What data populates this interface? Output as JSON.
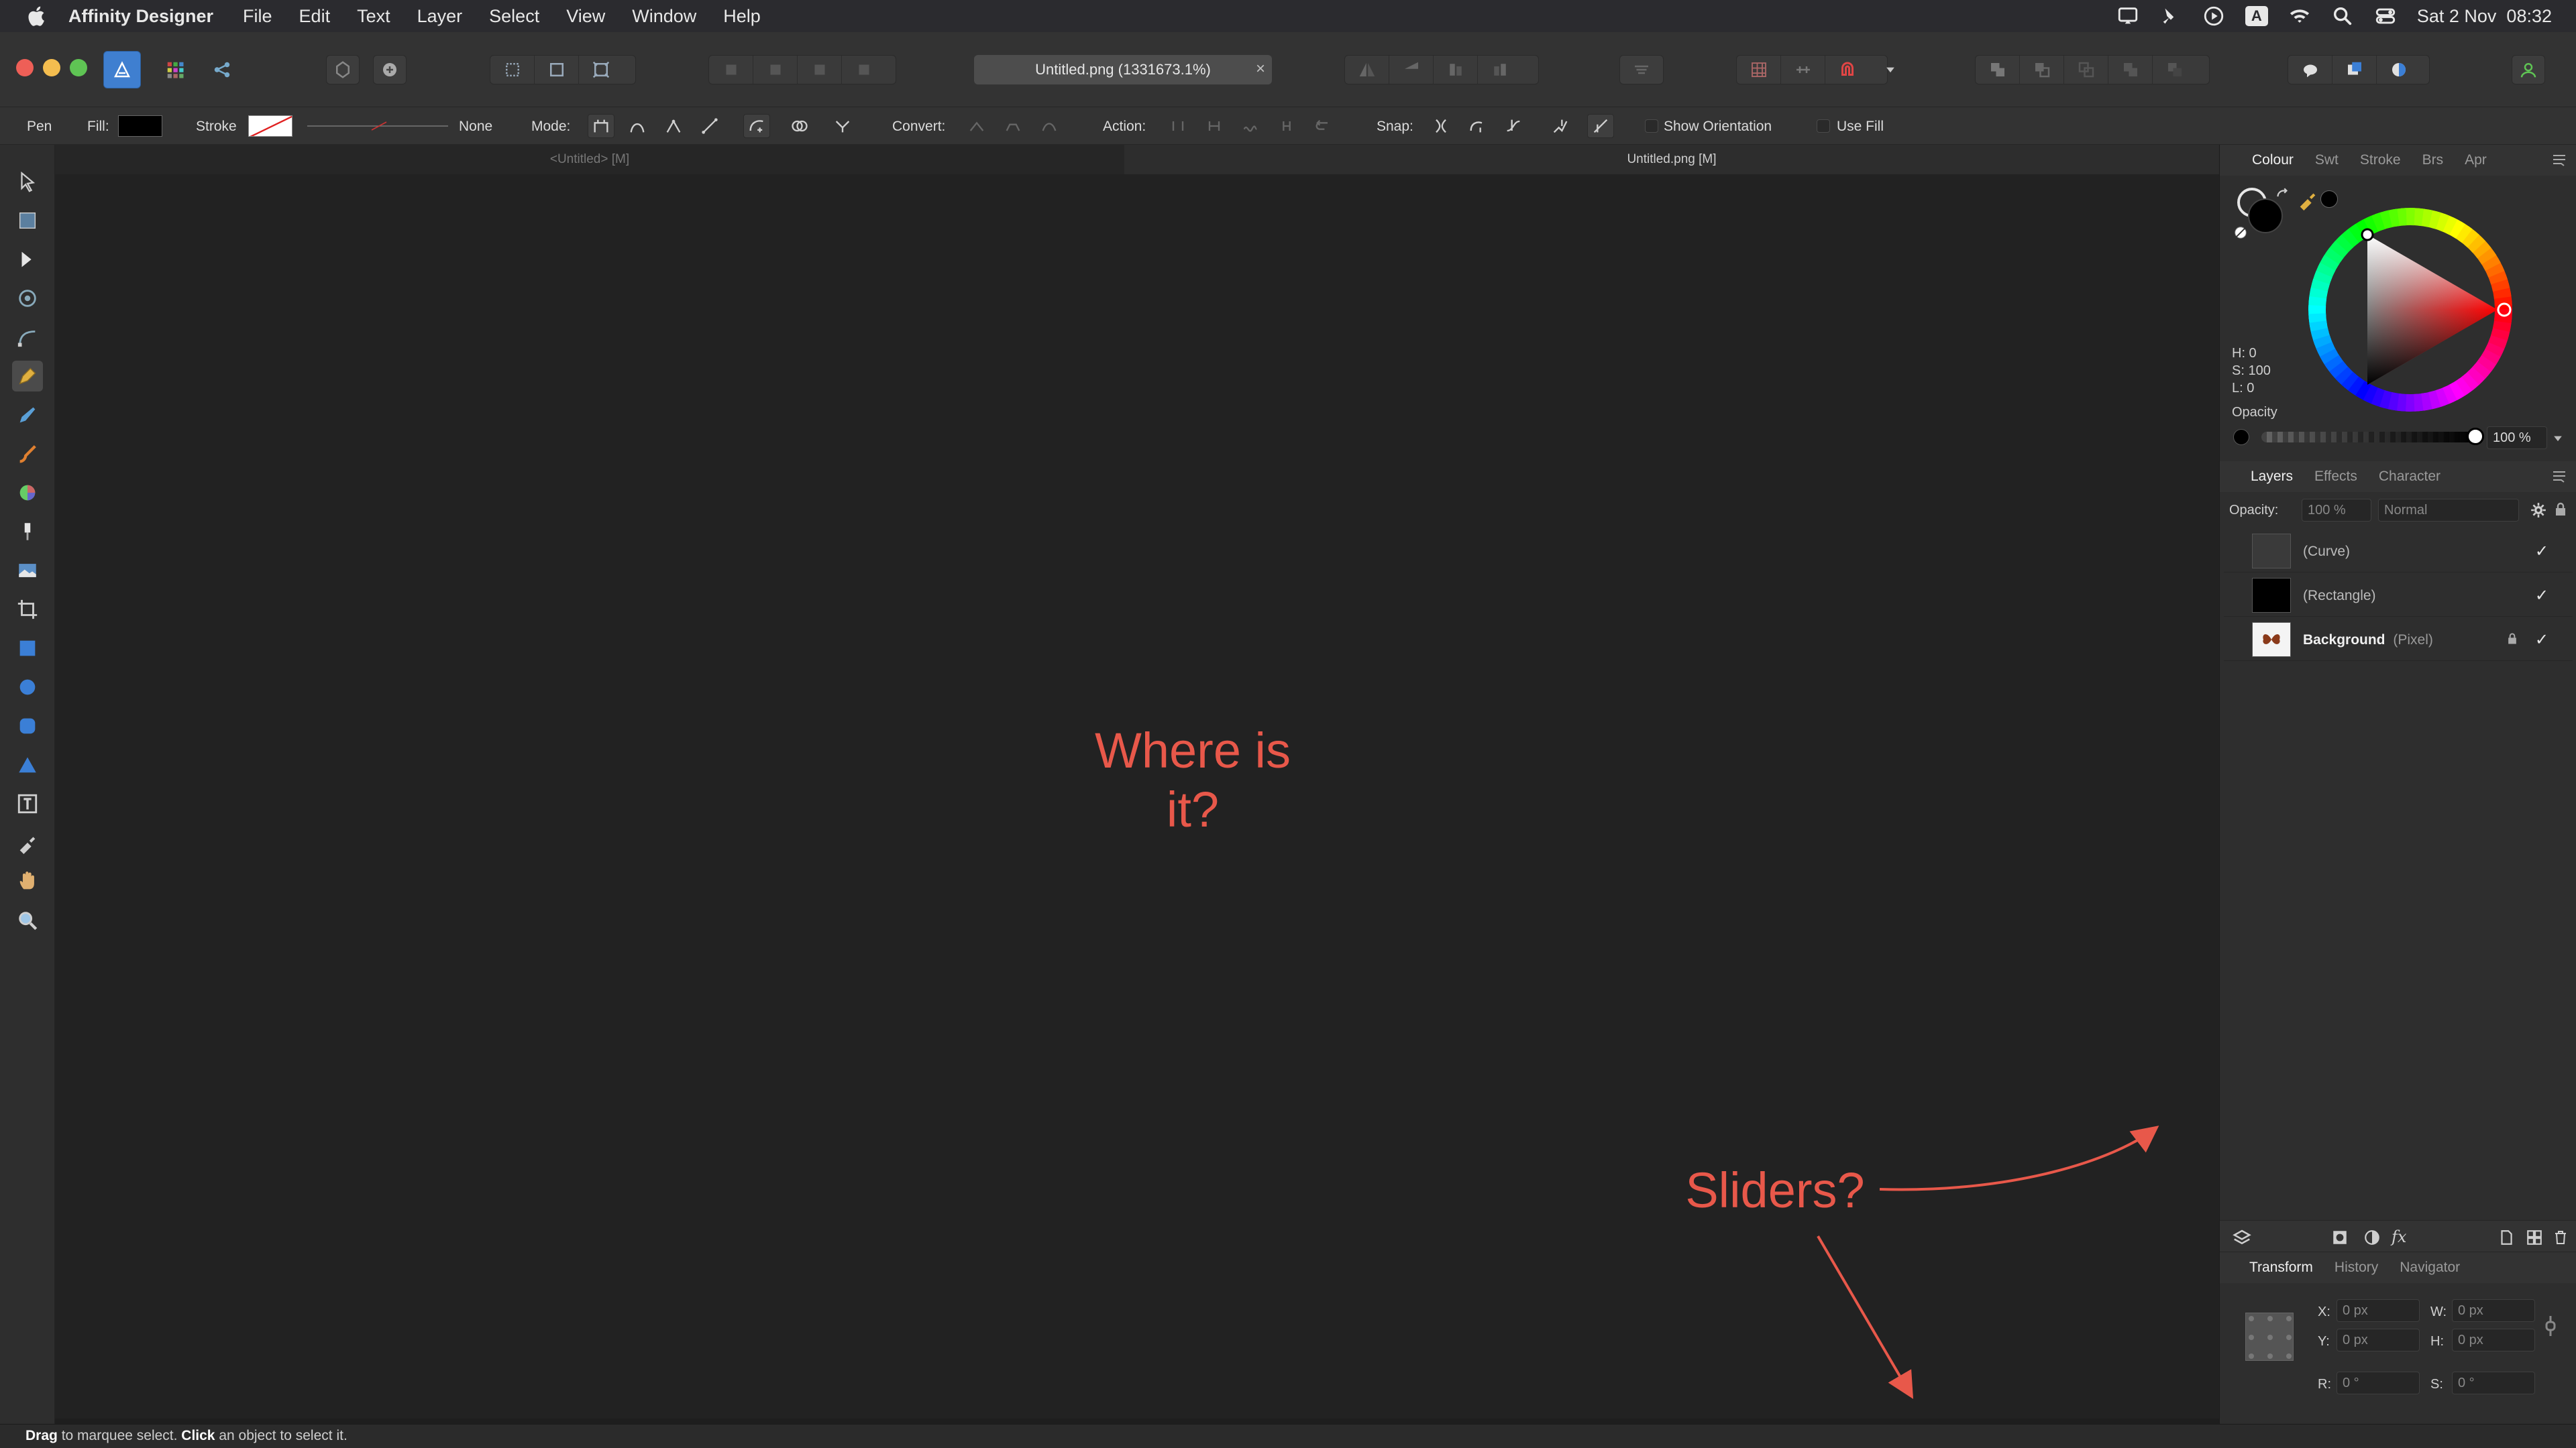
{
  "menubar": {
    "app_name": "Affinity Designer",
    "items": [
      "File",
      "Edit",
      "Text",
      "Layer",
      "Select",
      "View",
      "Window",
      "Help"
    ],
    "datetime": "Sat 2 Nov  08:32",
    "input_indicator": "A",
    "status_icons": [
      "screen-mirror-icon",
      "pen-status-icon",
      "play-circle-icon",
      "input-source-icon",
      "wifi-icon",
      "search-icon",
      "control-center-icon"
    ]
  },
  "toolbar": {
    "document_title": "Untitled.png (1331673.1%)",
    "close_glyph": "×",
    "persona_icons": [
      "designer-persona-icon",
      "pixel-persona-icon",
      "export-persona-icon"
    ]
  },
  "context_toolbar": {
    "tool_name": "Pen",
    "fill_label": "Fill:",
    "stroke_label": "Stroke",
    "stroke_style": "None",
    "mode_label": "Mode:",
    "convert_label": "Convert:",
    "action_label": "Action:",
    "snap_label": "Snap:",
    "show_orientation_label": "Show Orientation",
    "use_fill_label": "Use Fill",
    "fill_color": "#000000"
  },
  "tools": [
    "move-tool-icon",
    "artboard-tool-icon",
    "node-tool-icon",
    "corner-tool-icon",
    "point-transform-icon",
    "pen-tool-icon",
    "pencil-tool-icon",
    "vector-brush-icon",
    "fill-tool-icon",
    "transparency-tool-icon",
    "place-image-icon",
    "crop-tool-icon",
    "rectangle-tool-icon",
    "ellipse-tool-icon",
    "rounded-rect-tool-icon",
    "triangle-tool-icon",
    "artistic-text-icon",
    "color-picker-icon",
    "hand-tool-icon",
    "zoom-tool-icon"
  ],
  "document_tabs": [
    "<Untitled> [M]",
    "Untitled.png [M]"
  ],
  "canvas": {
    "annotation_1": "Where is",
    "annotation_1b": "it?",
    "annotation_2": "Sliders?",
    "annotation_color": "#e8584a"
  },
  "colour_panel": {
    "tabs": [
      "Colour",
      "Swt",
      "Stroke",
      "Brs",
      "Apr"
    ],
    "h": "H: 0",
    "s": "S: 100",
    "l": "L: 0",
    "opacity_label": "Opacity",
    "opacity_value": "100 %",
    "opacity_fraction": 1.0,
    "hue_degrees": 0
  },
  "layers_panel": {
    "tabs": [
      "Layers",
      "Effects",
      "Character"
    ],
    "opacity_label": "Opacity:",
    "opacity_value": "100 %",
    "blend_mode": "Normal",
    "layers": [
      {
        "name": "",
        "type": "(Curve)",
        "visible": "✓",
        "locked": false
      },
      {
        "name": "",
        "type": "(Rectangle)",
        "visible": "✓",
        "locked": false
      },
      {
        "name": "Background",
        "type": "(Pixel)",
        "visible": "✓",
        "locked": true
      }
    ]
  },
  "transform_panel": {
    "tabs": [
      "Transform",
      "History",
      "Navigator"
    ],
    "x_label": "X:",
    "x_value": "0 px",
    "y_label": "Y:",
    "y_value": "0 px",
    "w_label": "W:",
    "w_value": "0 px",
    "h_label": "H:",
    "h_value": "0 px",
    "r_label": "R:",
    "r_value": "0 °",
    "s_label": "S:",
    "s_value": "0 °"
  },
  "statusbar": {
    "drag": "Drag",
    "drag_rest": " to marquee select. ",
    "click": "Click",
    "click_rest": " an object to select it."
  }
}
